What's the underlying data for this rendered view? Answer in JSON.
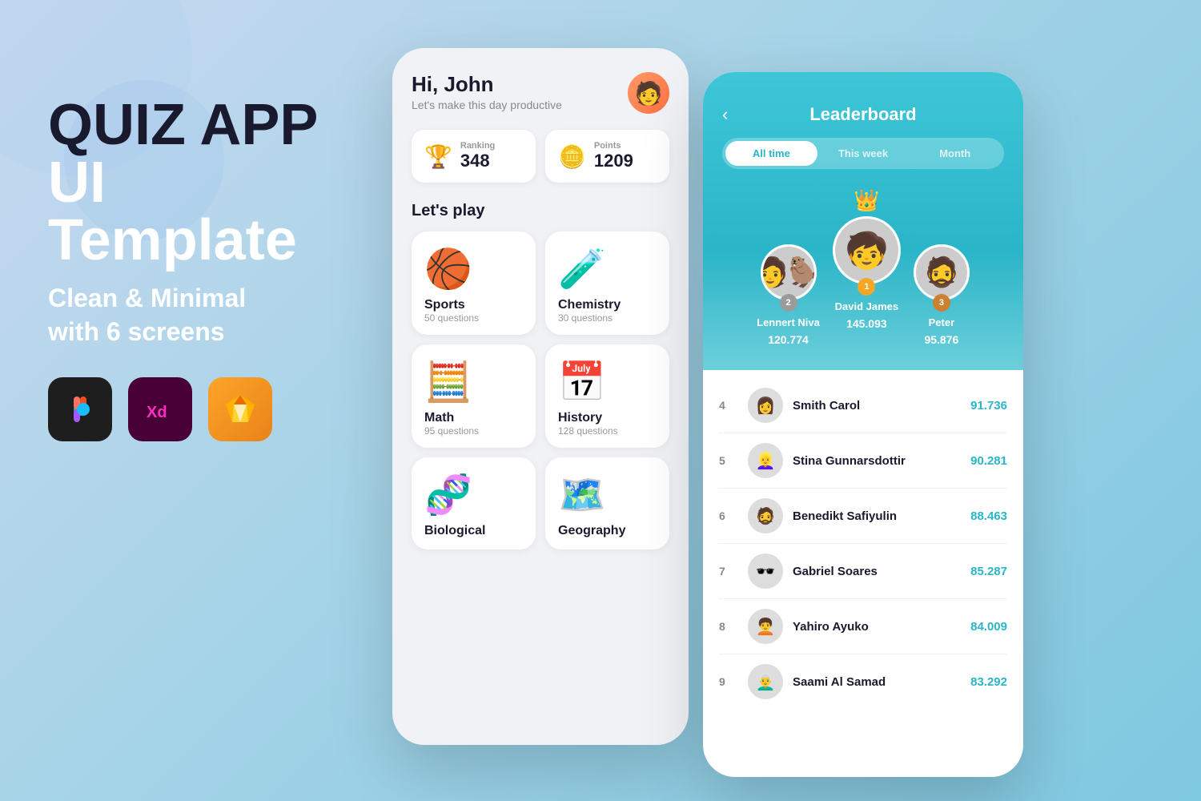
{
  "background": {
    "gradient_start": "#c8d8f0",
    "gradient_end": "#7ec8e0"
  },
  "left": {
    "title_line1": "QUIZ APP",
    "title_line2": "UI Template",
    "subtitle_line1": "Clean & Minimal",
    "subtitle_line2": "with 6 screens",
    "tools": [
      {
        "name": "Figma",
        "icon": "figma"
      },
      {
        "name": "Adobe XD",
        "icon": "xd"
      },
      {
        "name": "Sketch",
        "icon": "sketch"
      }
    ]
  },
  "phone1": {
    "greeting": "Hi, John",
    "subtitle": "Let's make this day productive",
    "stats": [
      {
        "label": "Ranking",
        "value": "348",
        "icon": "🏆"
      },
      {
        "label": "Points",
        "value": "1209",
        "icon": "🪙"
      }
    ],
    "section_title": "Let's play",
    "categories": [
      {
        "name": "Sports",
        "questions": "50 questions",
        "emoji": "🏀"
      },
      {
        "name": "Chemistry",
        "questions": "30 questions",
        "emoji": "🧪"
      },
      {
        "name": "Math",
        "questions": "95 questions",
        "emoji": "🧮"
      },
      {
        "name": "History",
        "questions": "128 questions",
        "emoji": "📅"
      },
      {
        "name": "Biological",
        "questions": "",
        "emoji": "🧬"
      },
      {
        "name": "Geography",
        "questions": "",
        "emoji": "🗺️"
      }
    ]
  },
  "phone2": {
    "title": "Leaderboard",
    "tabs": [
      "All time",
      "This week",
      "Month"
    ],
    "active_tab": 0,
    "top3": [
      {
        "rank": 2,
        "name": "Lennert Niva",
        "score": "120.774",
        "emoji": "👨"
      },
      {
        "rank": 1,
        "name": "David James",
        "score": "145.093",
        "emoji": "🧑"
      },
      {
        "rank": 3,
        "name": "Peter",
        "score": "95.876",
        "emoji": "👦"
      }
    ],
    "leaderboard": [
      {
        "rank": 4,
        "name": "Smith Carol",
        "score": "91.736",
        "emoji": "👩"
      },
      {
        "rank": 5,
        "name": "Stina Gunnarsdottir",
        "score": "90.281",
        "emoji": "👱‍♀️"
      },
      {
        "rank": 6,
        "name": "Benedikt Safiyulin",
        "score": "88.463",
        "emoji": "🧔"
      },
      {
        "rank": 7,
        "name": "Gabriel Soares",
        "score": "85.287",
        "emoji": "🕶️"
      },
      {
        "rank": 8,
        "name": "Yahiro Ayuko",
        "score": "84.009",
        "emoji": "🧑‍🦱"
      },
      {
        "rank": 9,
        "name": "Saami Al Samad",
        "score": "83.292",
        "emoji": "👨‍🦳"
      }
    ]
  }
}
